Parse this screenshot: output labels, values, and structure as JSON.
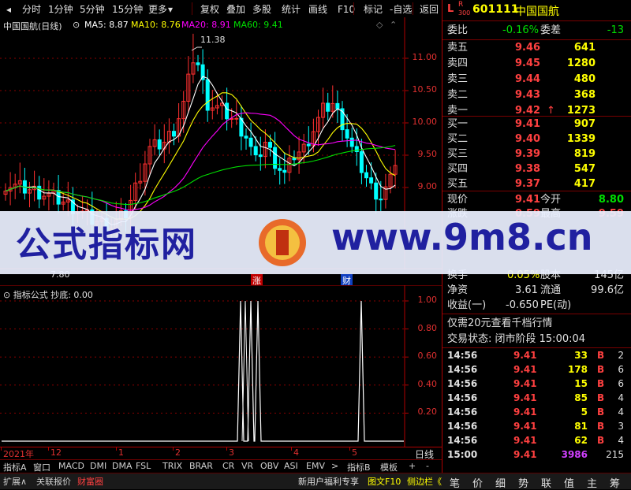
{
  "toolbar": {
    "items": [
      "分时",
      "1分钟",
      "5分钟",
      "15分钟",
      "更多",
      "复权",
      "叠加",
      "多股",
      "统计",
      "画线",
      "F10",
      "标记",
      "-自选",
      "返回"
    ]
  },
  "stock": {
    "code": "601111",
    "name": "中国国航",
    "flags": [
      "L",
      "R",
      "300"
    ]
  },
  "main_legend": {
    "title": "中国国航(日线)",
    "ma5": "MA5: 8.87",
    "ma10": "MA10: 8.76",
    "ma20": "MA20: 8.91",
    "ma60": "MA60: 9.41",
    "high_mark": "11.38",
    "low_mark": "7.80"
  },
  "price_axis": [
    "11.00",
    "10.50",
    "10.00",
    "9.50",
    "9.00"
  ],
  "events": {
    "zhang": "涨",
    "cai": "财"
  },
  "indicator": {
    "legend": "指标公式  抄底: 0.00",
    "axis": [
      "1.00",
      "0.80",
      "0.60",
      "0.40",
      "0.20"
    ]
  },
  "date_axis": [
    "2021年",
    "12",
    "1",
    "2",
    "3",
    "4",
    "5"
  ],
  "date_axis_right": "日线",
  "colors": {
    "up": "#ff3030",
    "down": "#00ffff",
    "ma5": "#ffffff",
    "ma10": "#ffff00",
    "ma20": "#ff00ff",
    "ma60": "#00e000",
    "grid": "#8a0000"
  },
  "quote": {
    "weibi_label": "委比",
    "weibi": "-0.16%",
    "weicha_label": "委差",
    "weicha": "-13",
    "asks": [
      {
        "label": "卖五",
        "price": "9.46",
        "vol": "641"
      },
      {
        "label": "卖四",
        "price": "9.45",
        "vol": "1280"
      },
      {
        "label": "卖三",
        "price": "9.44",
        "vol": "480"
      },
      {
        "label": "卖二",
        "price": "9.43",
        "vol": "368"
      },
      {
        "label": "卖一",
        "price": "9.42",
        "vol": "1273",
        "arrow": "↑"
      }
    ],
    "bids": [
      {
        "label": "买一",
        "price": "9.41",
        "vol": "907"
      },
      {
        "label": "买二",
        "price": "9.40",
        "vol": "1339"
      },
      {
        "label": "买三",
        "price": "9.39",
        "vol": "819"
      },
      {
        "label": "买四",
        "price": "9.38",
        "vol": "547"
      },
      {
        "label": "买五",
        "price": "9.37",
        "vol": "417"
      }
    ],
    "now_label": "现价",
    "now": "9.41",
    "open_label": "今开",
    "open": "8.80",
    "row2_label": "涨跌",
    "row2_val": "0.59",
    "row2b_label": "最高",
    "row2b_val": "9.59",
    "turnover_label": "换手",
    "turnover": "0.05%",
    "share_label": "股本",
    "share": "145亿",
    "net_label": "净资",
    "net": "3.61",
    "float_label": "流通",
    "float": "99.6亿",
    "eps_label": "收益(一)",
    "eps": "-0.650",
    "pe_label": "PE(动)",
    "pe": "",
    "promo": "仅需20元查看千档行情",
    "status": "交易状态: 闭市阶段 15:00:04"
  },
  "trades": [
    {
      "time": "14:56",
      "price": "9.41",
      "vol": "33",
      "side": "B",
      "n": "2"
    },
    {
      "time": "14:56",
      "price": "9.41",
      "vol": "178",
      "side": "B",
      "n": "6"
    },
    {
      "time": "14:56",
      "price": "9.41",
      "vol": "15",
      "side": "B",
      "n": "6"
    },
    {
      "time": "14:56",
      "price": "9.41",
      "vol": "85",
      "side": "B",
      "n": "4"
    },
    {
      "time": "14:56",
      "price": "9.41",
      "vol": "5",
      "side": "B",
      "n": "4"
    },
    {
      "time": "14:56",
      "price": "9.41",
      "vol": "81",
      "side": "B",
      "n": "3"
    },
    {
      "time": "14:56",
      "price": "9.41",
      "vol": "62",
      "side": "B",
      "n": "4"
    },
    {
      "time": "15:00",
      "price": "9.41",
      "vol": "3986",
      "side": "",
      "n": "215"
    }
  ],
  "tabs1": [
    "指标A",
    "窗口",
    "MACD",
    "DMI",
    "DMA",
    "FSL",
    "TRIX",
    "BRAR",
    "CR",
    "VR",
    "OBV",
    "ASI",
    "EMV",
    ">",
    "指标B",
    "模板",
    "+",
    "-"
  ],
  "tabs2_left": [
    "扩展∧",
    "关联报价",
    "财富圈"
  ],
  "tabs2_mid": [
    "新用户福利专享",
    "图文F10",
    "侧边栏《"
  ],
  "tabs2_right": [
    "笔",
    "价",
    "细",
    "势",
    "联",
    "值",
    "主",
    "筹"
  ],
  "watermark": {
    "text": "公式指标网",
    "url": "www.9m8.cn"
  }
}
